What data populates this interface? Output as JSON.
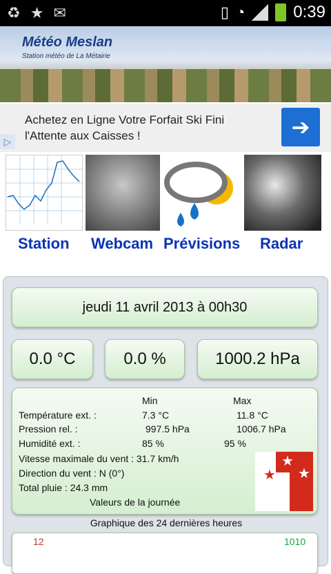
{
  "status_bar": {
    "time": "0:39"
  },
  "header": {
    "title": "Météo Meslan",
    "subtitle": "Station météo de La Métairie"
  },
  "ad": {
    "text_line1": "Achetez en Ligne Votre Forfait Ski Fini",
    "text_line2": "l'Attente aux Caisses !",
    "button_icon": "arrow-right-icon"
  },
  "nav": {
    "items": [
      {
        "label": "Station"
      },
      {
        "label": "Webcam"
      },
      {
        "label": "Prévisions"
      },
      {
        "label": "Radar"
      }
    ]
  },
  "weather": {
    "date": "jeudi 11 avril 2013 à 00h30",
    "temperature": "0.0 °C",
    "humidity": "0.0 %",
    "pressure": "1000.2 hPa",
    "stats": {
      "min_header": "Min",
      "max_header": "Max",
      "rows": [
        {
          "label": "Température ext. :",
          "min": "7.3 °C",
          "max": "11.8 °C"
        },
        {
          "label": "Pression rel. :",
          "min": "997.5 hPa",
          "max": "1006.7 hPa"
        },
        {
          "label": "Humidité ext. :",
          "min": "85 %",
          "max": "95 %"
        }
      ],
      "wind_max": "Vitesse maximale du vent : 31.7 km/h",
      "wind_dir": "Direction du vent : N (0°)",
      "rain": "Total pluie : 24.3 mm",
      "footer": "Valeurs de la journée"
    },
    "graph_title": "Graphique des 24 dernières heures",
    "graph_left_value": "12",
    "graph_right_value": "1010"
  },
  "colors": {
    "link": "#0a33b5",
    "box_green": "#d5eed0",
    "ad_button": "#1e6fd4"
  }
}
